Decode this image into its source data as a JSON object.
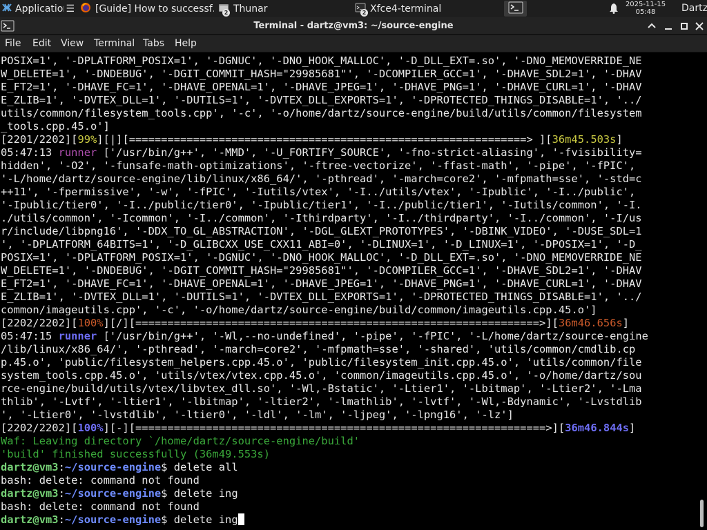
{
  "panel": {
    "applications_label": "Applications",
    "tasks": [
      {
        "label": "[Guide] How to successf…",
        "icon": "firefox-icon",
        "active": false
      },
      {
        "label": "Thunar",
        "icon": "folder-icon",
        "badge": "2",
        "active": false
      },
      {
        "label": "Xfce4-terminal",
        "icon": "terminal-icon",
        "badge": "2",
        "active": false
      }
    ],
    "clock_date": "2025-11-15",
    "clock_time": "05:48",
    "user": "Dartz"
  },
  "window": {
    "title": "Terminal - dartz@vm3: ~/source-engine"
  },
  "menu": {
    "file": "File",
    "edit": "Edit",
    "view": "View",
    "terminal": "Terminal",
    "tabs": "Tabs",
    "help": "Help"
  },
  "terminal": {
    "block1": "POSIX=1', '-DPLATFORM_POSIX=1', '-DGNUC', '-DNO_HOOK_MALLOC', '-D_DLL_EXT=.so', '-DNO_MEMOVERRIDE_NE\nW_DELETE=1', '-DNDEBUG', '-DGIT_COMMIT_HASH=\"29985681\"', '-DCOMPILER_GCC=1', '-DHAVE_SDL2=1', '-DHAV\nE_FT2=1', '-DHAVE_FC=1', '-DHAVE_OPENAL=1', '-DHAVE_JPEG=1', '-DHAVE_PNG=1', '-DHAVE_CURL=1', '-DHAV\nE_ZLIB=1', '-DVTEX_DLL=1', '-DUTILS=1', '-DVTEX_DLL_EXPORTS=1', '-DPROTECTED_THINGS_DISABLE=1', '../\nutils/common/filesystem_tools.cpp', '-c', '-o/home/dartz/source-engine/build/utils/common/filesystem\n_tools.cpp.45.o']",
    "progress1": {
      "a": "[2201/2202][",
      "pct": "99%",
      "b": "][|][==============================================================> ][",
      "time": "36m45.503s",
      "c": "]"
    },
    "runner1_time": "05:47:13 ",
    "runner_word": "runner",
    "block2": " ['/usr/bin/g++', '-MMD', '-U_FORTIFY_SOURCE', '-fno-strict-aliasing', '-fvisibility=\nhidden', '-O2', '-funsafe-math-optimizations', '-ftree-vectorize', '-ffast-math', '-pipe', '-fPIC',\n'-L/home/dartz/source-engine/lib/linux/x86_64/', '-pthread', '-march=core2', '-mfpmath=sse', '-std=c\n++11', '-fpermissive', '-w', '-fPIC', '-Iutils/vtex', '-I../utils/vtex', '-Ipublic', '-I../public',\n'-Ipublic/tier0', '-I../public/tier0', '-Ipublic/tier1', '-I../public/tier1', '-Iutils/common', '-I.\n./utils/common', '-Icommon', '-I../common', '-Ithirdparty', '-I../thirdparty', '-I../common', '-I/us\nr/include/libpng16', '-DDX_TO_GL_ABSTRACTION', '-DGL_GLEXT_PROTOTYPES', '-DBINK_VIDEO', '-DUSE_SDL=1\n', '-DPLATFORM_64BITS=1', '-D_GLIBCXX_USE_CXX11_ABI=0', '-DLINUX=1', '-D_LINUX=1', '-DPOSIX=1', '-D_\nPOSIX=1', '-DPLATFORM_POSIX=1', '-DGNUC', '-DNO_HOOK_MALLOC', '-D_DLL_EXT=.so', '-DNO_MEMOVERRIDE_NE\nW_DELETE=1', '-DNDEBUG', '-DGIT_COMMIT_HASH=\"29985681\"', '-DCOMPILER_GCC=1', '-DHAVE_SDL2=1', '-DHAV\nE_FT2=1', '-DHAVE_FC=1', '-DHAVE_OPENAL=1', '-DHAVE_JPEG=1', '-DHAVE_PNG=1', '-DHAVE_CURL=1', '-DHAV\nE_ZLIB=1', '-DVTEX_DLL=1', '-DUTILS=1', '-DVTEX_DLL_EXPORTS=1', '-DPROTECTED_THINGS_DISABLE=1', '../\ncommon/imageutils.cpp', '-c', '-o/home/dartz/source-engine/build/common/imageutils.cpp.45.o']",
    "progress2": {
      "a": "[2202/2202][",
      "pct": "100%",
      "b": "][/][===============================================================>][",
      "time": "36m46.656s",
      "c": "]"
    },
    "runner2_time": "05:47:15 ",
    "block3": " ['/usr/bin/g++', '-Wl,--no-undefined', '-pipe', '-fPIC', '-L/home/dartz/source-engine\n/lib/linux/x86_64/', '-pthread', '-march=core2', '-mfpmath=sse', '-shared', 'utils/common/cmdlib.cp\np.45.o', 'public/filesystem_helpers.cpp.45.o', 'public/filesystem_init.cpp.45.o', 'utils/common/file\nsystem_tools.cpp.45.o', 'utils/vtex/vtex.cpp.45.o', 'common/imageutils.cpp.45.o', '-o/home/dartz/sou\nrce-engine/build/utils/vtex/libvtex_dll.so', '-Wl,-Bstatic', '-Ltier1', '-Lbitmap', '-Ltier2', '-Lma\nthlib', '-Lvtf', '-ltier1', '-lbitmap', '-ltier2', '-lmathlib', '-lvtf', '-Wl,-Bdynamic', '-Lvstdlib\n', '-Ltier0', '-lvstdlib', '-ltier0', '-ldl', '-lm', '-ljpeg', '-lpng16', '-lz']",
    "progress3": {
      "a": "[2202/2202][",
      "pct": "100%",
      "b": "][-][================================================================>][",
      "time": "36m46.844s",
      "c": "]"
    },
    "waf_leaving": "Waf: Leaving directory `/home/dartz/source-engine/build'",
    "build_finished": "'build' finished successfully (36m49.553s)",
    "prompt_user": "dartz@vm3",
    "prompt_colon": ":",
    "prompt_path": "~/source-engine",
    "prompt_dollar": "$ ",
    "cmd1": "delete all",
    "err1": "bash: delete: command not found",
    "cmd2": "delete ing",
    "err2": "bash: delete: command not found",
    "cmd3": "delete ing"
  },
  "colors": {
    "panel_bg": "#1e1e1e",
    "terminal_bg": "#000000",
    "prompt_user": "#76d076",
    "prompt_path": "#6f8cff"
  }
}
